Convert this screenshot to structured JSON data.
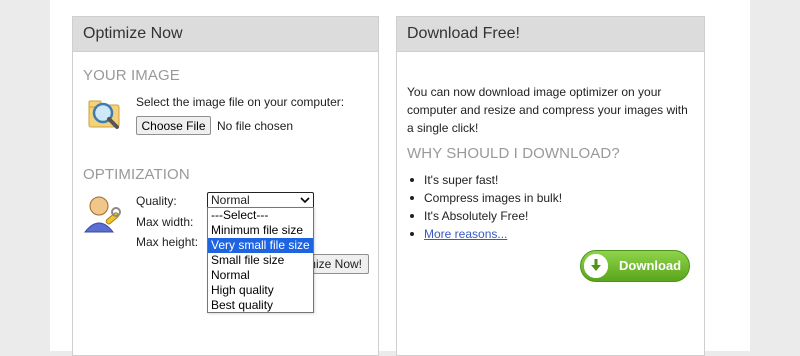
{
  "left_panel": {
    "title": "Optimize Now",
    "your_image": {
      "heading": "YOUR IMAGE",
      "instruction": "Select the image file on your computer:",
      "file_button": "Choose File",
      "file_status": "No file chosen"
    },
    "optimization": {
      "heading": "OPTIMIZATION",
      "quality_label": "Quality:",
      "quality_value": "Normal",
      "max_width_label": "Max width:",
      "max_height_label": "Max height:",
      "optimize_button": "Optimize Now!",
      "dropdown_options": [
        "---Select---",
        "Minimum file size",
        "Very small file size",
        "Small file size",
        "Normal",
        "High quality",
        "Best quality"
      ],
      "highlighted_option": "Very small file size"
    }
  },
  "right_panel": {
    "title": "Download Free!",
    "description_line1": "You can now download image optimizer on your",
    "description_line2": "computer and resize and compress your images with",
    "description_line3": "a single click!",
    "why_heading": "WHY SHOULD I DOWNLOAD?",
    "bullets": [
      "It's super fast!",
      "Compress images in bulk!",
      "It's Absolutely Free!"
    ],
    "more_link": "More reasons...",
    "download_button": "Download"
  },
  "colors": {
    "panel_header": "#dcdcdc",
    "section_heading": "#999999",
    "link": "#3a59c4",
    "download_green": "#5aa51b",
    "dropdown_highlight": "#1e63e0"
  },
  "icons": [
    "magnifier-folder-icon",
    "user-settings-icon",
    "chevron-down-icon",
    "download-arrow-icon"
  ]
}
